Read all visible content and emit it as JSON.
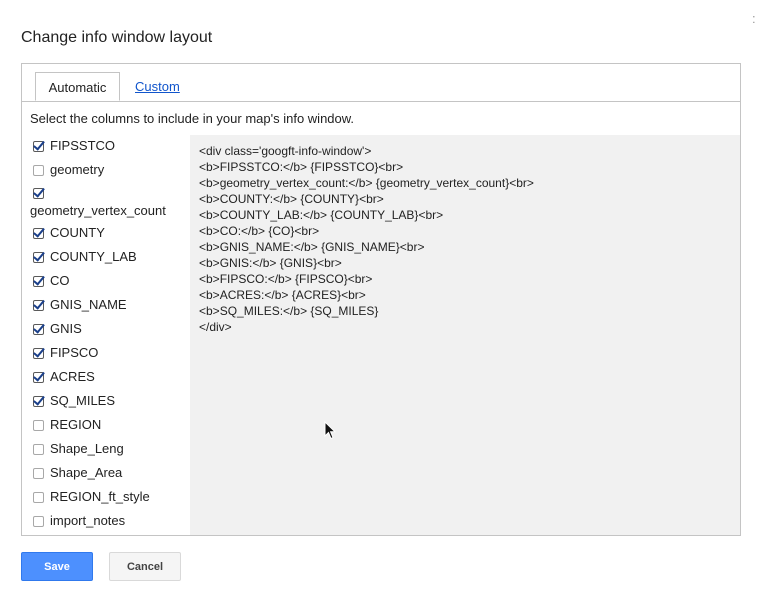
{
  "dialog": {
    "title": "Change info window layout",
    "close_glyph": ":"
  },
  "tabs": [
    {
      "label": "Automatic",
      "active": true
    },
    {
      "label": "Custom",
      "active": false
    }
  ],
  "instructions": "Select the columns to include in your map's info window.",
  "columns": [
    {
      "label": "FIPSSTCO",
      "checked": true
    },
    {
      "label": "geometry",
      "checked": false
    },
    {
      "label": "geometry_vertex_count",
      "checked": true
    },
    {
      "label": "COUNTY",
      "checked": true
    },
    {
      "label": "COUNTY_LAB",
      "checked": true
    },
    {
      "label": "CO",
      "checked": true
    },
    {
      "label": "GNIS_NAME",
      "checked": true
    },
    {
      "label": "GNIS",
      "checked": true
    },
    {
      "label": "FIPSCO",
      "checked": true
    },
    {
      "label": "ACRES",
      "checked": true
    },
    {
      "label": "SQ_MILES",
      "checked": true
    },
    {
      "label": "REGION",
      "checked": false
    },
    {
      "label": "Shape_Leng",
      "checked": false
    },
    {
      "label": "Shape_Area",
      "checked": false
    },
    {
      "label": "REGION_ft_style",
      "checked": false
    },
    {
      "label": "import_notes",
      "checked": false
    }
  ],
  "template_code": [
    "<div class='googft-info-window'>",
    "<b>FIPSSTCO:</b> {FIPSSTCO}<br>",
    "<b>geometry_vertex_count:</b> {geometry_vertex_count}<br>",
    "<b>COUNTY:</b> {COUNTY}<br>",
    "<b>COUNTY_LAB:</b> {COUNTY_LAB}<br>",
    "<b>CO:</b> {CO}<br>",
    "<b>GNIS_NAME:</b> {GNIS_NAME}<br>",
    "<b>GNIS:</b> {GNIS}<br>",
    "<b>FIPSCO:</b> {FIPSCO}<br>",
    "<b>ACRES:</b> {ACRES}<br>",
    "<b>SQ_MILES:</b> {SQ_MILES}",
    "</div>"
  ],
  "buttons": {
    "save": "Save",
    "cancel": "Cancel"
  },
  "colors": {
    "primary_button": "#4d90fe",
    "link": "#1155cc",
    "code_background": "#f1f1f1"
  }
}
